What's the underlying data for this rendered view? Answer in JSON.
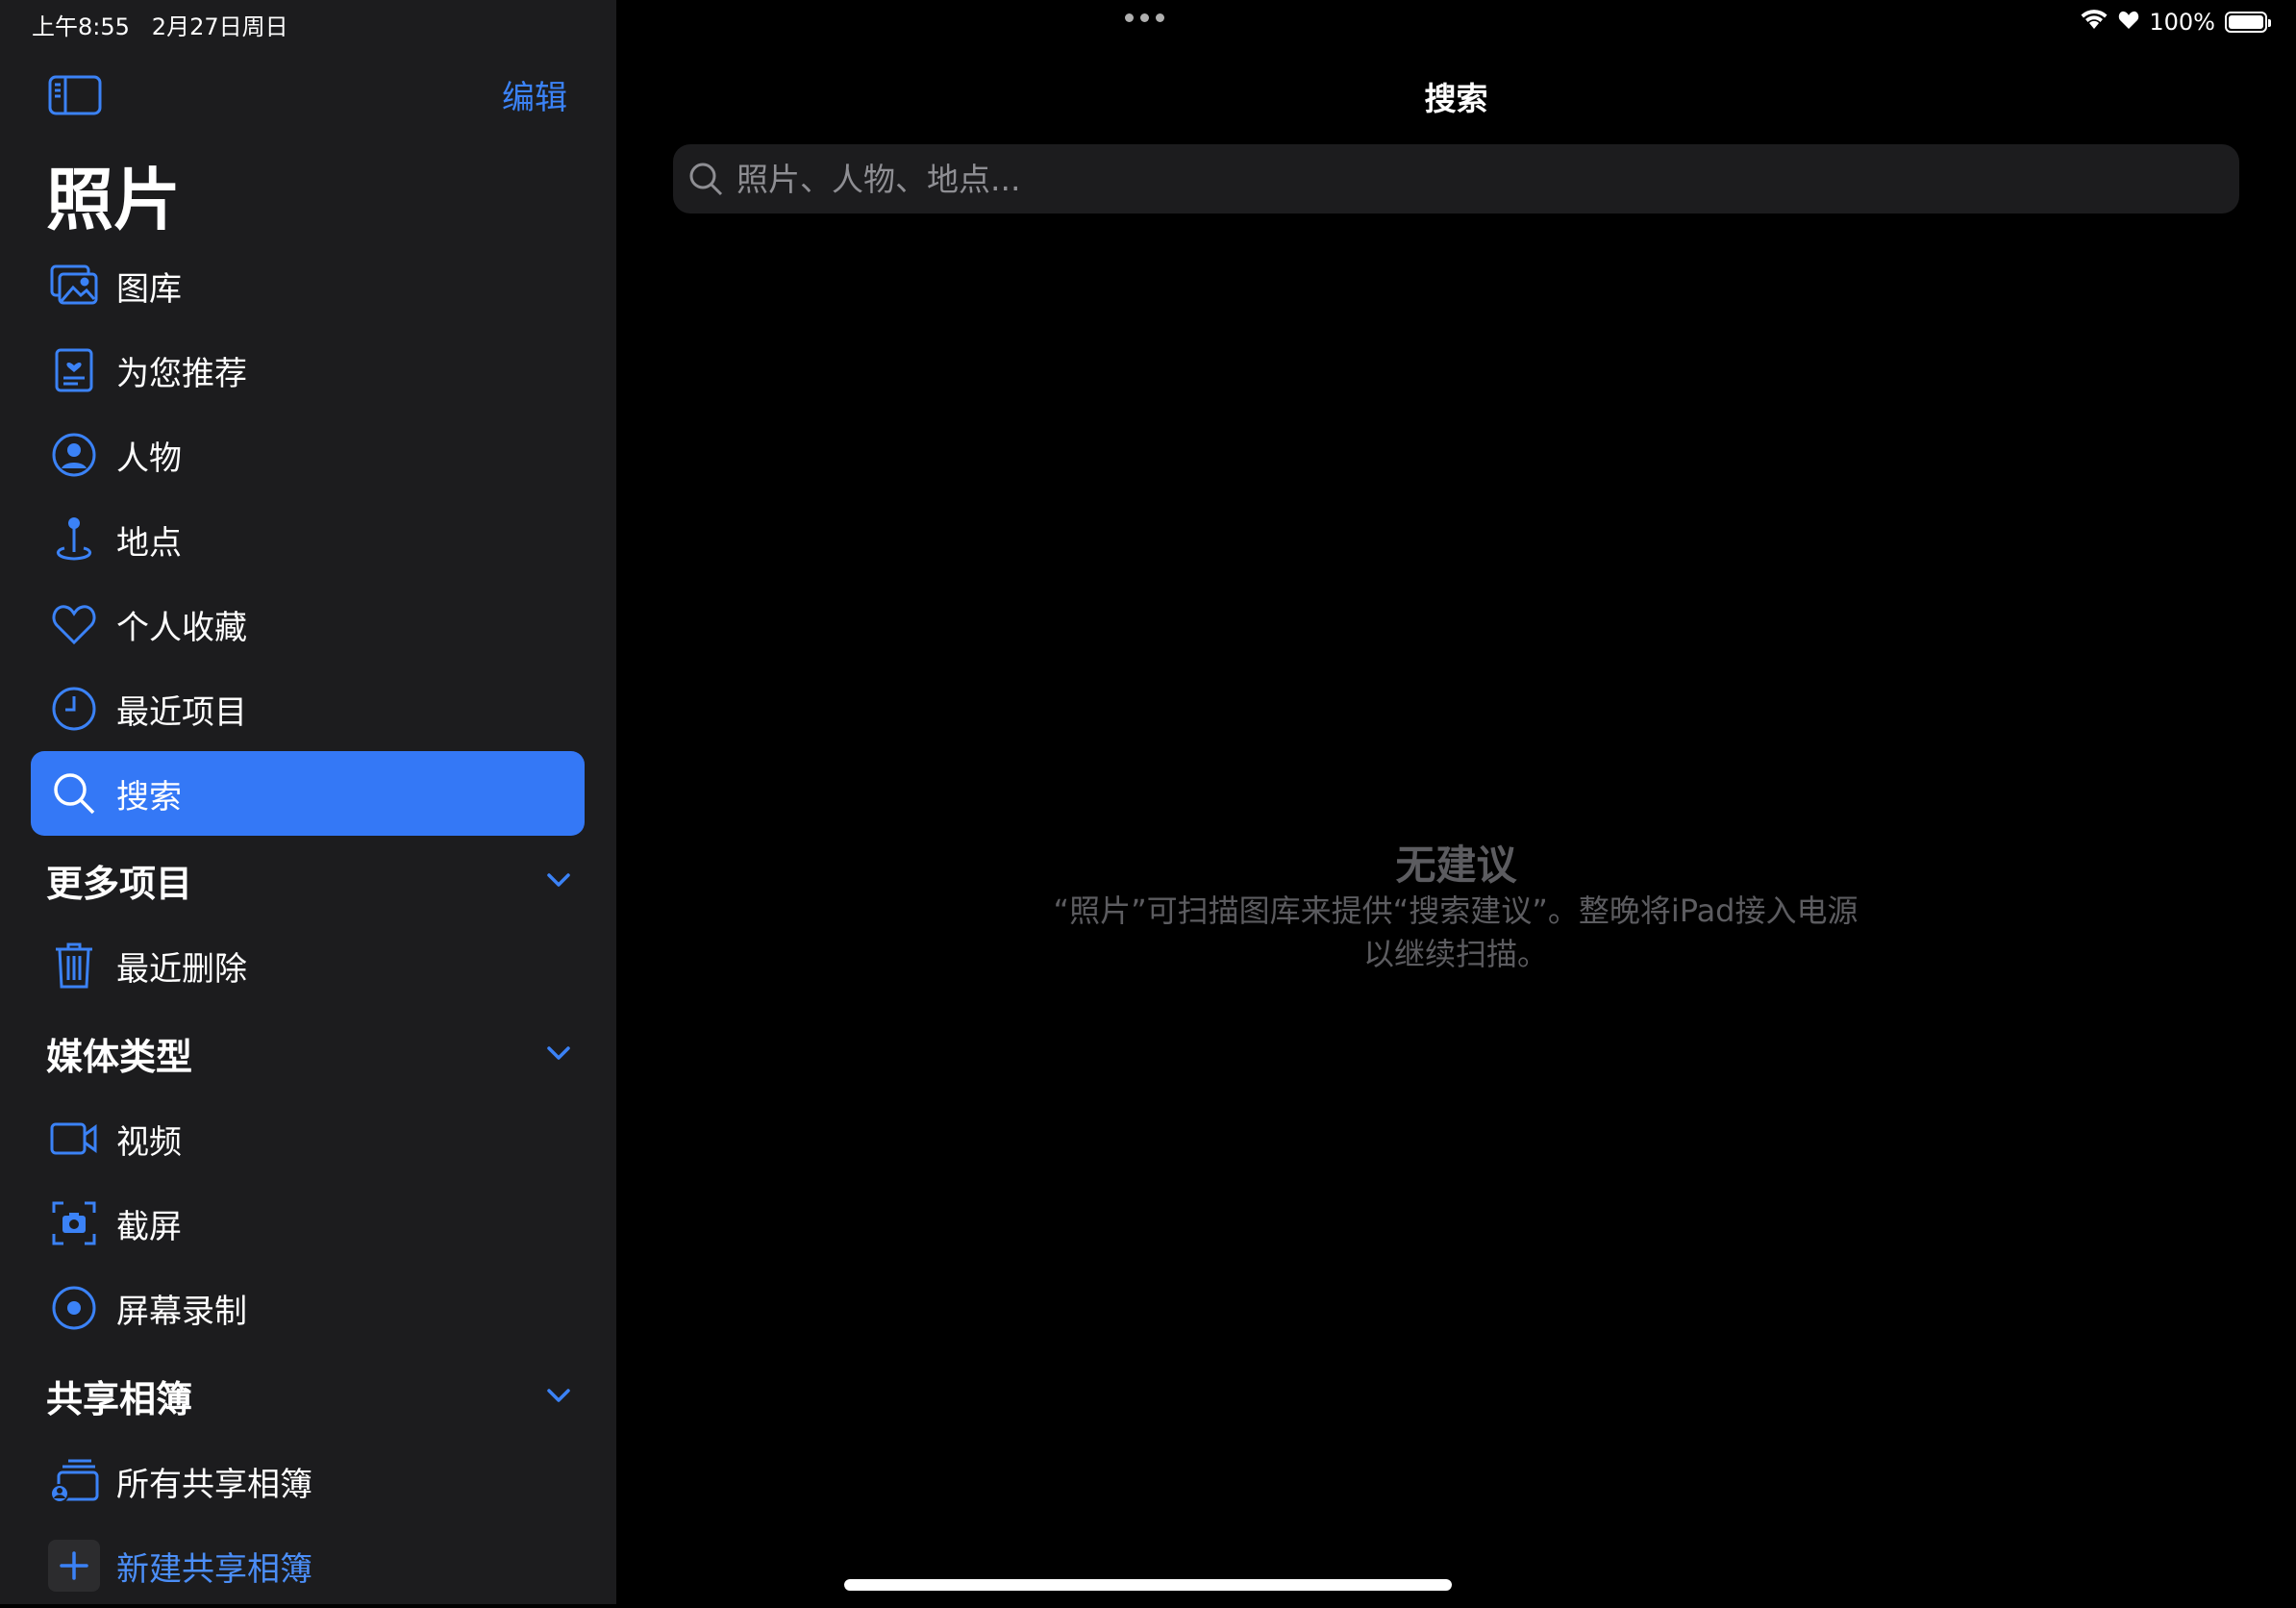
{
  "status_bar": {
    "time": "上午8:55",
    "date": "2月27日周日",
    "battery": "100%",
    "battery_level": 1.0
  },
  "sidebar": {
    "edit_label": "编辑",
    "title": "照片",
    "items": [
      {
        "label": "图库",
        "icon": "photo-library-icon"
      },
      {
        "label": "为您推荐",
        "icon": "for-you-icon"
      },
      {
        "label": "人物",
        "icon": "person-circle-icon"
      },
      {
        "label": "地点",
        "icon": "map-pin-icon"
      },
      {
        "label": "个人收藏",
        "icon": "heart-icon"
      },
      {
        "label": "最近项目",
        "icon": "clock-icon"
      },
      {
        "label": "搜索",
        "icon": "search-icon",
        "selected": true
      }
    ],
    "sections": [
      {
        "title": "更多项目",
        "items": [
          {
            "label": "最近删除",
            "icon": "trash-icon"
          }
        ]
      },
      {
        "title": "媒体类型",
        "items": [
          {
            "label": "视频",
            "icon": "video-camera-icon"
          },
          {
            "label": "截屏",
            "icon": "screenshot-icon"
          },
          {
            "label": "屏幕录制",
            "icon": "screen-record-icon"
          }
        ]
      },
      {
        "title": "共享相簿",
        "items": [
          {
            "label": "所有共享相簿",
            "icon": "shared-albums-icon"
          },
          {
            "label": "新建共享相簿",
            "icon": "plus-icon"
          }
        ]
      }
    ]
  },
  "main": {
    "title": "搜索",
    "search_placeholder": "照片、人物、地点...",
    "empty_title": "无建议",
    "empty_description": "“照片”可扫描图库来提供“搜索建议”。整晚将iPad接入电源以继续扫描。"
  },
  "colors": {
    "accent": "#3478f6",
    "sidebar_bg": "#1c1c1e",
    "main_bg": "#000000",
    "muted_text": "#5c5c60"
  }
}
